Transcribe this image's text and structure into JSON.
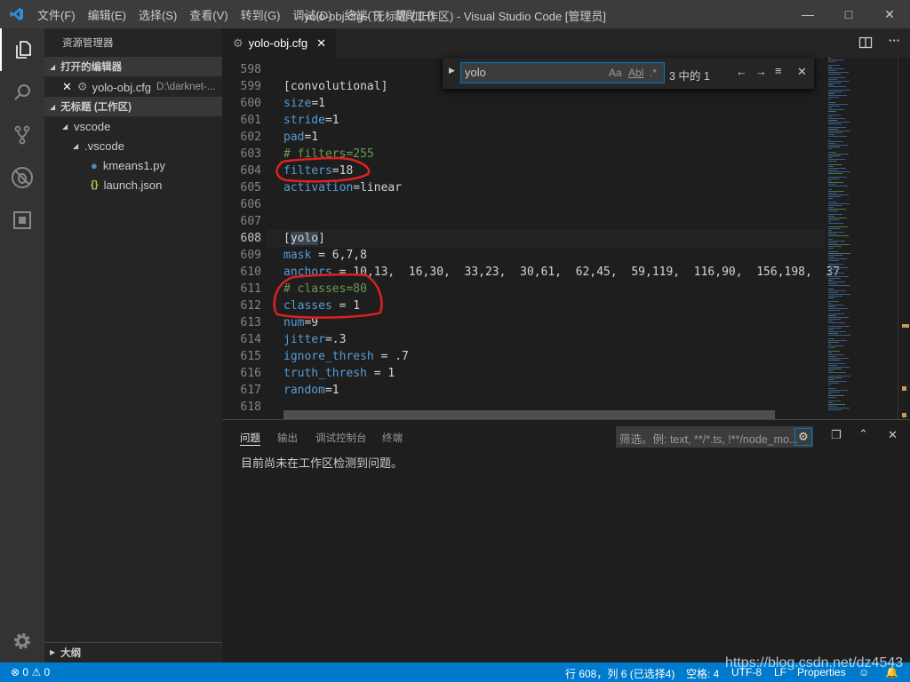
{
  "titlebar": {
    "menus": [
      "文件(F)",
      "编辑(E)",
      "选择(S)",
      "查看(V)",
      "转到(G)",
      "调试(D)",
      "终端(T)",
      "帮助(H)"
    ],
    "title": "yolo-obj.cfg - 无标题 (工作区) - Visual Studio Code [管理员]"
  },
  "activity": [
    "files-icon",
    "search-icon",
    "source-control-icon",
    "debug-icon",
    "extensions-icon",
    "settings-gear-icon"
  ],
  "sidebar": {
    "header": "资源管理器",
    "open_editors": "打开的编辑器",
    "open_file": {
      "name": "yolo-obj.cfg",
      "path": "D:\\darknet-..."
    },
    "workspace": "无标题 (工作区)",
    "tree": [
      {
        "label": "vscode",
        "depth": 0
      },
      {
        "label": ".vscode",
        "depth": 1
      },
      {
        "label": "kmeans1.py",
        "depth": 2,
        "icon": "python-icon"
      },
      {
        "label": "launch.json",
        "depth": 2,
        "icon": "json-braces-icon"
      }
    ],
    "outline": "大纲"
  },
  "tab": {
    "label": "yolo-obj.cfg"
  },
  "editor": {
    "lines": [
      {
        "n": "598",
        "parts": []
      },
      {
        "n": "599",
        "parts": [
          [
            "v",
            "[convolutional]"
          ]
        ]
      },
      {
        "n": "600",
        "parts": [
          [
            "k",
            "size"
          ],
          [
            "v",
            "=1"
          ]
        ]
      },
      {
        "n": "601",
        "parts": [
          [
            "k",
            "stride"
          ],
          [
            "v",
            "=1"
          ]
        ]
      },
      {
        "n": "602",
        "parts": [
          [
            "k",
            "pad"
          ],
          [
            "v",
            "=1"
          ]
        ]
      },
      {
        "n": "603",
        "parts": [
          [
            "c",
            "# filters=255"
          ]
        ]
      },
      {
        "n": "604",
        "parts": [
          [
            "k",
            "filters"
          ],
          [
            "v",
            "=18"
          ]
        ]
      },
      {
        "n": "605",
        "parts": [
          [
            "k",
            "activation"
          ],
          [
            "v",
            "=linear"
          ]
        ]
      },
      {
        "n": "606",
        "parts": []
      },
      {
        "n": "607",
        "parts": []
      },
      {
        "n": "608",
        "parts": [
          [
            "v",
            "["
          ],
          [
            "sel",
            "yolo"
          ],
          [
            "v",
            "]"
          ]
        ]
      },
      {
        "n": "609",
        "parts": [
          [
            "k",
            "mask"
          ],
          [
            "v",
            " = 6,7,8"
          ]
        ]
      },
      {
        "n": "610",
        "parts": [
          [
            "k",
            "anchors"
          ],
          [
            "v",
            " = 10,13,  16,30,  33,23,  30,61,  62,45,  59,119,  116,90,  156,198,  37"
          ]
        ]
      },
      {
        "n": "611",
        "parts": [
          [
            "c",
            "# classes=80"
          ]
        ]
      },
      {
        "n": "612",
        "parts": [
          [
            "k",
            "classes"
          ],
          [
            "v",
            " = 1"
          ]
        ]
      },
      {
        "n": "613",
        "parts": [
          [
            "k",
            "num"
          ],
          [
            "v",
            "=9"
          ]
        ]
      },
      {
        "n": "614",
        "parts": [
          [
            "k",
            "jitter"
          ],
          [
            "v",
            "=.3"
          ]
        ]
      },
      {
        "n": "615",
        "parts": [
          [
            "k",
            "ignore_thresh"
          ],
          [
            "v",
            " = .7"
          ]
        ]
      },
      {
        "n": "616",
        "parts": [
          [
            "k",
            "truth_thresh"
          ],
          [
            "v",
            " = 1"
          ]
        ]
      },
      {
        "n": "617",
        "parts": [
          [
            "k",
            "random"
          ],
          [
            "v",
            "=1"
          ]
        ]
      },
      {
        "n": "618",
        "parts": []
      }
    ],
    "current_line": "608"
  },
  "find": {
    "value": "yolo",
    "match_case": "Aa",
    "whole_word": "Abl",
    "regex": ".*",
    "count": "3 中的 1"
  },
  "panel": {
    "tabs": [
      "问题",
      "输出",
      "调试控制台",
      "终端"
    ],
    "active": "问题",
    "filter_placeholder": "筛选。例: text, **/*.ts, !**/node_mo...",
    "message": "目前尚未在工作区检测到问题。"
  },
  "status": {
    "errors": "0",
    "warnings": "0",
    "position": "行 608，列 6 (已选择4)",
    "spaces": "空格: 4",
    "encoding": "UTF-8",
    "eol": "LF",
    "language": "Properties",
    "watermark": "https://blog.csdn.net/dz4543"
  },
  "colors": {
    "accent": "#007acc",
    "annotation": "#e02020"
  }
}
